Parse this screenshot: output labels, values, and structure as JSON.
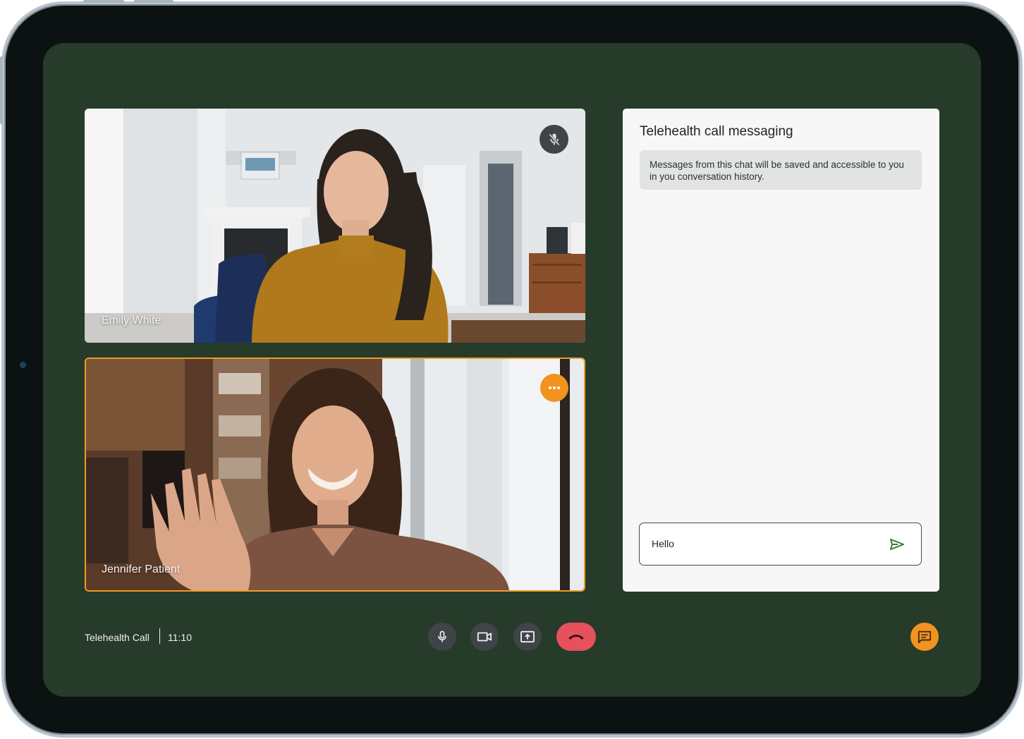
{
  "call": {
    "title": "Telehealth Call",
    "time": "11:10"
  },
  "participants": [
    {
      "name": "Emily White",
      "mic_icon": "mic-off-icon"
    },
    {
      "name": "Jennifer Patient",
      "menu_icon": "more-horizontal-icon",
      "active": true
    }
  ],
  "chat": {
    "title": "Telehealth call messaging",
    "notice": "Messages from this chat will be saved and accessible to you in you conversation history.",
    "input_value": "Hello",
    "send_icon": "send-icon"
  },
  "controls": [
    {
      "name": "microphone",
      "icon": "mic-icon"
    },
    {
      "name": "camera",
      "icon": "videocam-icon"
    },
    {
      "name": "share-screen",
      "icon": "present-to-all-icon"
    },
    {
      "name": "end-call",
      "icon": "call-end-icon"
    }
  ],
  "colors": {
    "screen_bg": "#263b2a",
    "accent": "#f29320",
    "end_call": "#e5525b",
    "control_bg": "#3e4448",
    "send_icon": "#3d7a3a"
  }
}
